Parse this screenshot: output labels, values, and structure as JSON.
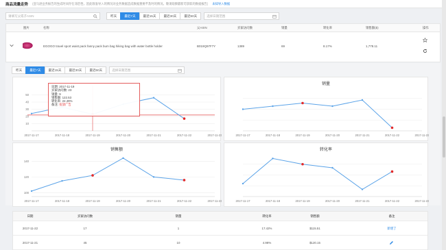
{
  "header": {
    "title": "商品流量走势",
    "note": "(亚马逊业务报告的生成时间存在滞后性，因此限准导入的情况对业务数据造成数据重要不及时的情况，敬请观察最新可获取的数据报告)",
    "link": "未知导入数据"
  },
  "search": {
    "placeholder": "请填写父或子ASIN"
  },
  "ranges": [
    "昨天",
    "最近7天",
    "最近15天",
    "最近30天",
    "最近60天"
  ],
  "active_range": "最近7天",
  "date_placeholder": "选择日期范围",
  "product_table": {
    "headers": [
      "图片",
      "名称",
      "父ASIN",
      "买家访问数",
      "销量",
      "转化率",
      "销售额($)",
      "操作"
    ],
    "row": {
      "name": "EGOGO travel sport waist pack fanny pack bum bag hiking bag with water bottle holder",
      "asin": "B019Q97F7Y",
      "visits": "1389",
      "sales": "69",
      "conversion": "8.17%",
      "revenue": "1,778.11"
    }
  },
  "tooltip": {
    "date": "日期: 2017-11-19",
    "visits": "买家访问数: 23",
    "units": "销量: 9",
    "revenue": "销售额: 122.53",
    "conversion": "转化率: 22.49%",
    "note_label": "备注:",
    "note_value": "投放广告"
  },
  "chart_data": [
    {
      "type": "line",
      "title": "",
      "xlabel": "",
      "ylabel": "",
      "ylim": [
        0,
        60
      ],
      "categories": [
        "2017-11-17",
        "2017-11-18",
        "2017-11-19",
        "2017-11-20",
        "2017-11-21",
        "2017-11-22",
        "2017-11-23"
      ],
      "series": [
        {
          "values": [
            24,
            33,
            23,
            37,
            46,
            17
          ]
        }
      ],
      "highlight": [
        2,
        5
      ],
      "threshold": 22,
      "yticks": [
        50,
        40,
        30,
        20,
        10
      ]
    },
    {
      "type": "line",
      "title": "销量",
      "xlabel": "",
      "ylabel": "",
      "categories": [
        "2017-11-17",
        "2017-11-18",
        "2017-11-19",
        "2017-11-20",
        "2017-11-21",
        "2017-11-22",
        "2017-11-23"
      ],
      "series": [
        {
          "values": [
            7,
            8,
            9,
            8,
            10,
            1
          ]
        }
      ],
      "highlight": [
        2,
        5
      ],
      "ylim": [
        0,
        14
      ],
      "yticks": []
    },
    {
      "type": "line",
      "title": "销售额",
      "xlabel": "",
      "ylabel": "",
      "ylim": [
        95,
        150
      ],
      "categories": [
        "2017-11-17",
        "2017-11-18",
        "2017-11-19",
        "2017-11-20",
        "2017-11-21",
        "2017-11-22",
        "2017-11-23"
      ],
      "series": [
        {
          "values": [
            102,
            115,
            122,
            144,
            120,
            116
          ]
        }
      ],
      "highlight": [
        2,
        5
      ],
      "yticks": [
        140,
        120,
        100
      ]
    },
    {
      "type": "line",
      "title": "转化率",
      "xlabel": "",
      "ylabel": "",
      "ylim": [
        0,
        30
      ],
      "categories": [
        "2017-11-17",
        "2017-11-18",
        "2017-11-19",
        "2017-11-20",
        "2017-11-21",
        "2017-11-22",
        "2017-11-23"
      ],
      "series": [
        {
          "values": [
            9,
            26.5,
            22.5,
            20,
            5,
            17.4
          ]
        }
      ],
      "highlight": [
        2,
        5
      ],
      "yticks": []
    }
  ],
  "detail_table": {
    "headers": [
      "日期",
      "买家访问数",
      "销量",
      "转化率",
      "销售额",
      "备注"
    ],
    "rows": [
      [
        "2017-11-22",
        "17",
        "1",
        "17.42%",
        "$115.51",
        "新增了"
      ],
      [
        "2017-11-21",
        "45",
        "10",
        "4.98%",
        "$120.15",
        ""
      ]
    ]
  },
  "colors": {
    "accent": "#2f8be6",
    "line": "#5ba3e8",
    "highlight": "#e32a2a"
  }
}
